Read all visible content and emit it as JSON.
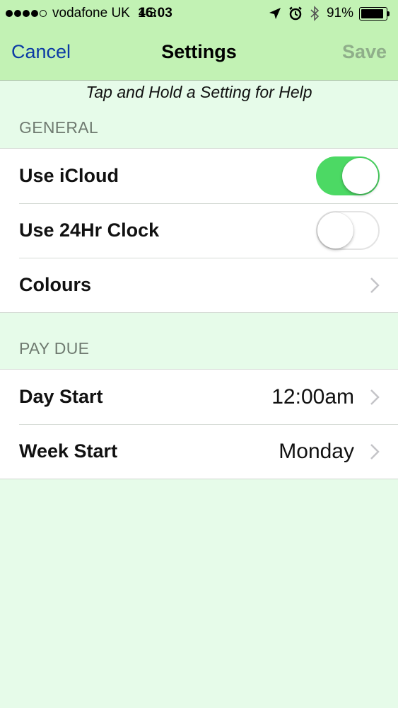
{
  "status_bar": {
    "signal_bars_filled": 4,
    "signal_bars_total": 5,
    "carrier": "vodafone UK",
    "network": "4G",
    "time": "16:03",
    "battery_percent": "91%",
    "battery_level": 0.91,
    "icons": [
      "location-arrow-icon",
      "alarm-clock-icon",
      "bluetooth-icon"
    ]
  },
  "nav": {
    "cancel_label": "Cancel",
    "title": "Settings",
    "save_label": "Save"
  },
  "help_text": "Tap and Hold a Setting for Help",
  "sections": {
    "general": {
      "header": "GENERAL",
      "use_icloud": {
        "label": "Use iCloud",
        "on": true
      },
      "use_24hr": {
        "label": "Use 24Hr Clock",
        "on": false
      },
      "colours": {
        "label": "Colours"
      }
    },
    "pay_due": {
      "header": "PAY DUE",
      "day_start": {
        "label": "Day Start",
        "value": "12:00am"
      },
      "week_start": {
        "label": "Week Start",
        "value": "Monday"
      }
    }
  },
  "colors": {
    "bar_background": "#c2f2b4",
    "page_background": "#e6fbe9",
    "toggle_on": "#4cd964",
    "cancel_link": "#0b3aa5",
    "save_disabled": "#8fae8a"
  }
}
